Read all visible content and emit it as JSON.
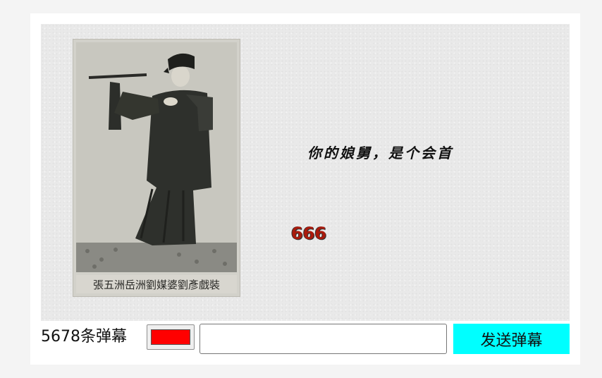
{
  "stage": {
    "photo": {
      "caption": "張五洲岳洲劉媒婆劉彥戲裝"
    },
    "danmaku": [
      {
        "text": "你的娘舅，是个会首",
        "color": "#111111"
      },
      {
        "text": "666",
        "color": "#aa1a0c"
      }
    ]
  },
  "controls": {
    "count_label": "5678条弹幕",
    "color_picker_value": "#ff0000",
    "input_value": "",
    "send_label": "发送弹幕",
    "send_color": "#00ffff"
  }
}
